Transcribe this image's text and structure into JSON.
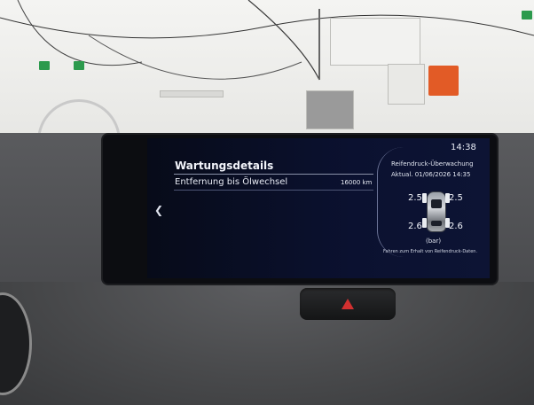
{
  "infotainment": {
    "clock": "14:38",
    "back_icon": "chevron-left",
    "maintenance": {
      "title": "Wartungsdetails",
      "row_label": "Entfernung bis Ölwechsel",
      "row_value": "16000 km"
    },
    "tpms": {
      "title": "Reifendruck-Überwachung",
      "updated": "Aktual.   01/06/2026 14:35",
      "front_left": "2.5",
      "front_right": "2.5",
      "rear_left": "2.6",
      "rear_right": "2.6",
      "unit": "(bar)",
      "note": "Fahren zum Erhalt von Reifendruck-Daten."
    }
  },
  "colors": {
    "screen_bg": "#0b1130",
    "text": "#e8ecf6",
    "hazard_symbol": "#d23030"
  }
}
